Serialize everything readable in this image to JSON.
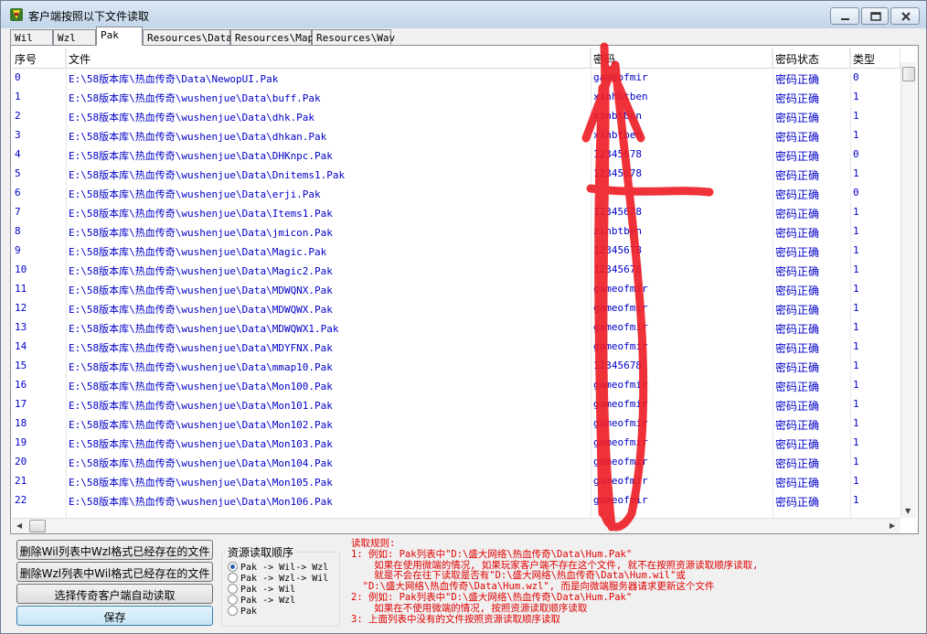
{
  "window": {
    "title": "客户端按照以下文件读取"
  },
  "tabs": [
    {
      "label": "Wil",
      "active": false
    },
    {
      "label": "Wzl",
      "active": false
    },
    {
      "label": "Pak",
      "active": true
    },
    {
      "label": "Resources\\Data",
      "active": false
    },
    {
      "label": "Resources\\Map",
      "active": false
    },
    {
      "label": "Resources\\Wav",
      "active": false
    }
  ],
  "table": {
    "headers": {
      "index": "序号",
      "file": "文件",
      "password": "密码",
      "status": "密码状态",
      "type": "类型"
    },
    "rows": [
      {
        "index": "0",
        "file": "E:\\58版本库\\热血传奇\\Data\\NewopUI.Pak",
        "password": "gameofmir",
        "status": "密码正确",
        "type": "0"
      },
      {
        "index": "1",
        "file": "E:\\58版本库\\热血传奇\\wushenjue\\Data\\buff.Pak",
        "password": "xinhbtben",
        "status": "密码正确",
        "type": "1"
      },
      {
        "index": "2",
        "file": "E:\\58版本库\\热血传奇\\wushenjue\\Data\\dhk.Pak",
        "password": "xinbtben",
        "status": "密码正确",
        "type": "1"
      },
      {
        "index": "3",
        "file": "E:\\58版本库\\热血传奇\\wushenjue\\Data\\dhkan.Pak",
        "password": "xinbtben",
        "status": "密码正确",
        "type": "1"
      },
      {
        "index": "4",
        "file": "E:\\58版本库\\热血传奇\\wushenjue\\Data\\DHKnpc.Pak",
        "password": "12345678",
        "status": "密码正确",
        "type": "0"
      },
      {
        "index": "5",
        "file": "E:\\58版本库\\热血传奇\\wushenjue\\Data\\Dnitems1.Pak",
        "password": "12345678",
        "status": "密码正确",
        "type": "1"
      },
      {
        "index": "6",
        "file": "E:\\58版本库\\热血传奇\\wushenjue\\Data\\erji.Pak",
        "password": "",
        "status": "密码正确",
        "type": "0"
      },
      {
        "index": "7",
        "file": "E:\\58版本库\\热血传奇\\wushenjue\\Data\\Items1.Pak",
        "password": "12345678",
        "status": "密码正确",
        "type": "1"
      },
      {
        "index": "8",
        "file": "E:\\58版本库\\热血传奇\\wushenjue\\Data\\jmicon.Pak",
        "password": "xinbtben",
        "status": "密码正确",
        "type": "1"
      },
      {
        "index": "9",
        "file": "E:\\58版本库\\热血传奇\\wushenjue\\Data\\Magic.Pak",
        "password": "12345678",
        "status": "密码正确",
        "type": "1"
      },
      {
        "index": "10",
        "file": "E:\\58版本库\\热血传奇\\wushenjue\\Data\\Magic2.Pak",
        "password": "12345678",
        "status": "密码正确",
        "type": "1"
      },
      {
        "index": "11",
        "file": "E:\\58版本库\\热血传奇\\wushenjue\\Data\\MDWQNX.Pak",
        "password": "gameofmir",
        "status": "密码正确",
        "type": "1"
      },
      {
        "index": "12",
        "file": "E:\\58版本库\\热血传奇\\wushenjue\\Data\\MDWQWX.Pak",
        "password": "gameofmir",
        "status": "密码正确",
        "type": "1"
      },
      {
        "index": "13",
        "file": "E:\\58版本库\\热血传奇\\wushenjue\\Data\\MDWQWX1.Pak",
        "password": "gameofmir",
        "status": "密码正确",
        "type": "1"
      },
      {
        "index": "14",
        "file": "E:\\58版本库\\热血传奇\\wushenjue\\Data\\MDYFNX.Pak",
        "password": "gameofmir",
        "status": "密码正确",
        "type": "1"
      },
      {
        "index": "15",
        "file": "E:\\58版本库\\热血传奇\\wushenjue\\Data\\mmap10.Pak",
        "password": "12345678",
        "status": "密码正确",
        "type": "1"
      },
      {
        "index": "16",
        "file": "E:\\58版本库\\热血传奇\\wushenjue\\Data\\Mon100.Pak",
        "password": "gameofmir",
        "status": "密码正确",
        "type": "1"
      },
      {
        "index": "17",
        "file": "E:\\58版本库\\热血传奇\\wushenjue\\Data\\Mon101.Pak",
        "password": "gameofmir",
        "status": "密码正确",
        "type": "1"
      },
      {
        "index": "18",
        "file": "E:\\58版本库\\热血传奇\\wushenjue\\Data\\Mon102.Pak",
        "password": "gameofmir",
        "status": "密码正确",
        "type": "1"
      },
      {
        "index": "19",
        "file": "E:\\58版本库\\热血传奇\\wushenjue\\Data\\Mon103.Pak",
        "password": "gameofmir",
        "status": "密码正确",
        "type": "1"
      },
      {
        "index": "20",
        "file": "E:\\58版本库\\热血传奇\\wushenjue\\Data\\Mon104.Pak",
        "password": "gameofmir",
        "status": "密码正确",
        "type": "1"
      },
      {
        "index": "21",
        "file": "E:\\58版本库\\热血传奇\\wushenjue\\Data\\Mon105.Pak",
        "password": "gameofmir",
        "status": "密码正确",
        "type": "1"
      },
      {
        "index": "22",
        "file": "E:\\58版本库\\热血传奇\\wushenjue\\Data\\Mon106.Pak",
        "password": "gameofmir",
        "status": "密码正确",
        "type": "1"
      }
    ],
    "row_text_color": "#0000c8"
  },
  "buttons": {
    "delete_wil": "删除Wil列表中Wzl格式已经存在的文件",
    "delete_wzl": "删除Wzl列表中Wil格式已经存在的文件",
    "auto_read": "选择传奇客户端自动读取",
    "save": "保存"
  },
  "resource_order": {
    "title": "资源读取顺序",
    "options": [
      {
        "label": "Pak -> Wil-> Wzl",
        "selected": true
      },
      {
        "label": "Pak -> Wzl-> Wil",
        "selected": false
      },
      {
        "label": "Pak -> Wil",
        "selected": false
      },
      {
        "label": "Pak -> Wzl",
        "selected": false
      },
      {
        "label": "Pak",
        "selected": false
      }
    ]
  },
  "rules": {
    "lines": [
      "读取规则:",
      "1: 例如: Pak列表中\"D:\\盛大网络\\热血传奇\\Data\\Hum.Pak\"",
      "    如果在使用微端的情况, 如果玩家客户端不存在这个文件, 就不在按照资源读取顺序读取,",
      "    就是不会在往下读取是否有\"D:\\盛大网络\\热血传奇\\Data\\Hum.wil\"或",
      "  \"D:\\盛大网络\\热血传奇\\Data\\Hum.wzl\", 而是向微端服务器请求更新这个文件",
      "2: 例如: Pak列表中\"D:\\盛大网络\\热血传奇\\Data\\Hum.Pak\"",
      "    如果在不使用微端的情况, 按照资源读取顺序读取",
      "3: 上面列表中没有的文件按照资源读取顺序读取"
    ],
    "color": "#e00000"
  },
  "annotation_color": "#ee1c24"
}
